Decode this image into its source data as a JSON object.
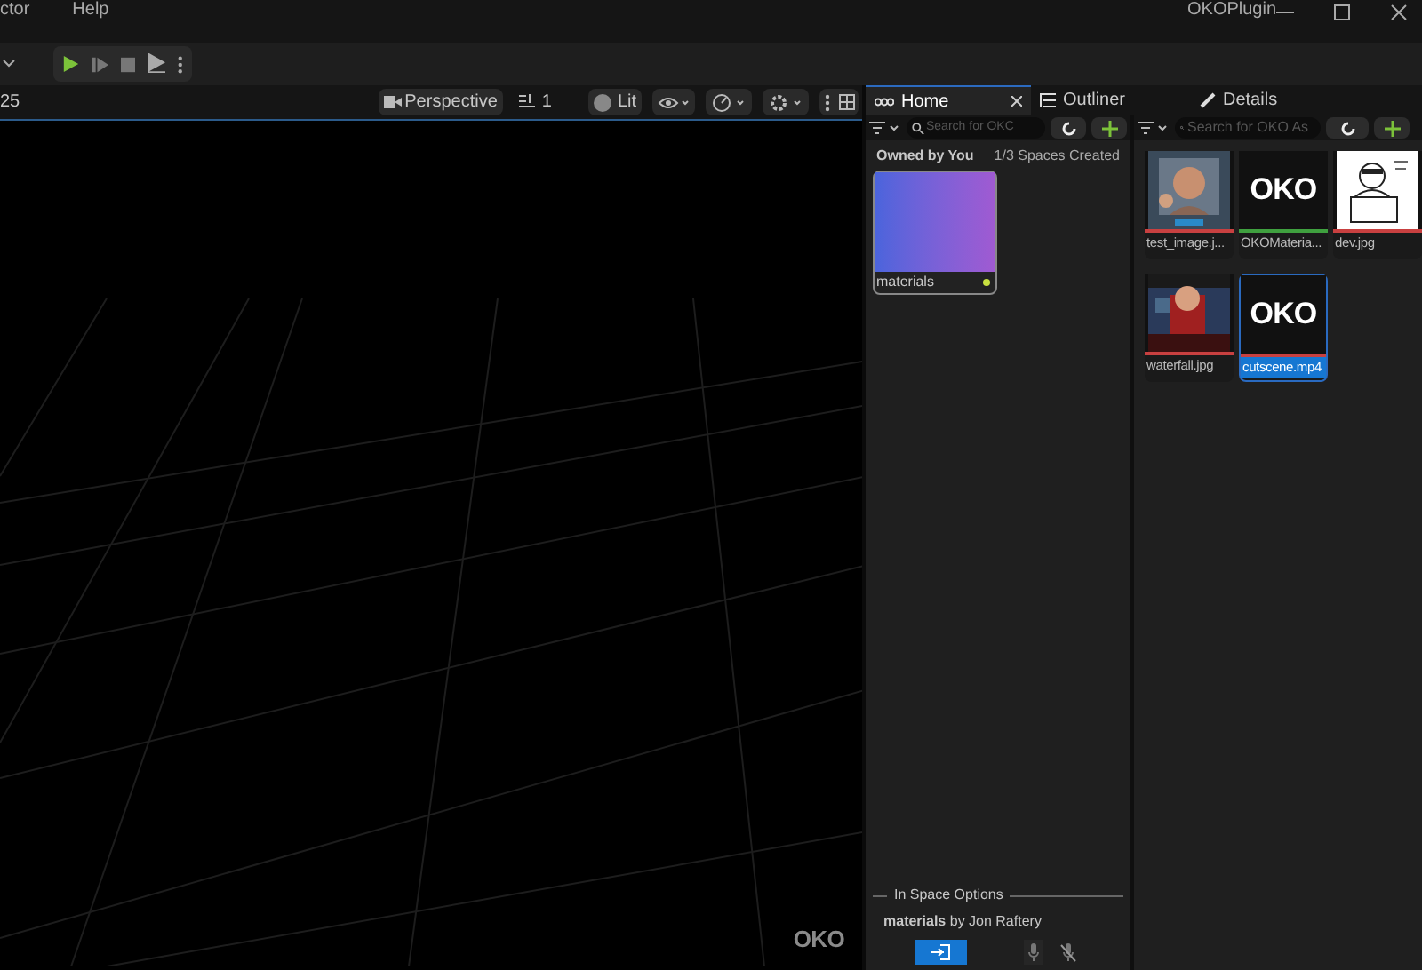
{
  "menu": [
    "ctor",
    "Help"
  ],
  "app_title": "OKOPlugin",
  "viewport_toolbar": {
    "snap": "25",
    "view_mode": "Perspective",
    "layout": "1",
    "lighting": "Lit"
  },
  "viewport": {
    "watermark": "OKO"
  },
  "tabs": [
    {
      "label": "Home",
      "selected": true,
      "closable": true
    },
    {
      "label": "Outliner",
      "selected": false,
      "closable": false
    },
    {
      "label": "Details",
      "selected": false,
      "closable": false
    }
  ],
  "home": {
    "search": {
      "placeholder": "Search for OKC"
    },
    "heading": "Owned by You",
    "count": "1/3 Spaces Created",
    "spaces": [
      {
        "name": "materials",
        "online": true
      }
    ],
    "options": {
      "title": "In Space Options",
      "owner": "**materials** by Jon Raftery",
      "mic_muted": true
    }
  },
  "assets": {
    "search": {
      "placeholder": "Search for OKO As"
    },
    "items": [
      {
        "name": "test_image.j...",
        "color": "#c84040",
        "selected": false
      },
      {
        "name": "OKOMateria...",
        "kind": "logo",
        "logo": "OKO",
        "color": "#3fa03f",
        "selected": false
      },
      {
        "name": "dev.jpg",
        "kind": "drawing",
        "color": "#c84040",
        "selected": false
      },
      {
        "name": "waterfall.jpg",
        "kind": "poster",
        "color": "#c84040",
        "selected": false
      },
      {
        "name": "cutscene.mp4",
        "kind": "logo",
        "logo": "OKO",
        "color": "#c84040",
        "selected": true
      }
    ]
  }
}
